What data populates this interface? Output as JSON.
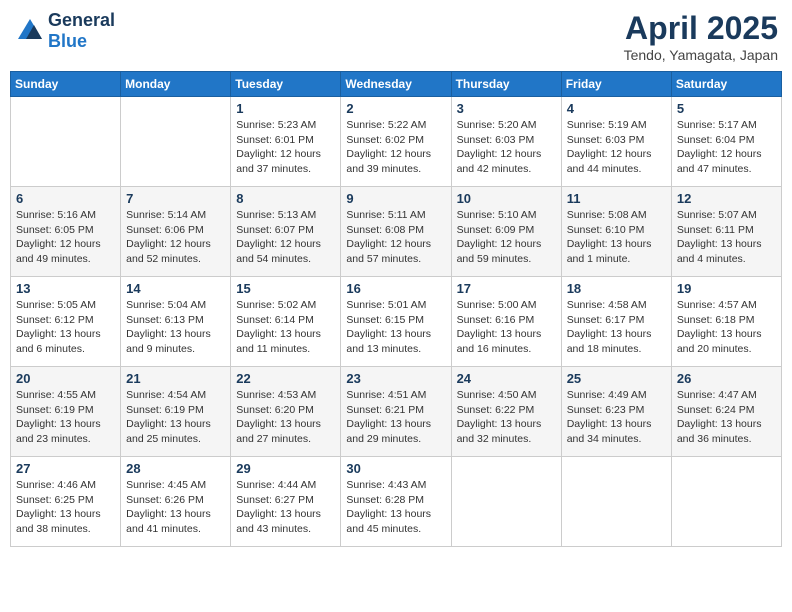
{
  "logo": {
    "general": "General",
    "blue": "Blue"
  },
  "title": "April 2025",
  "location": "Tendo, Yamagata, Japan",
  "days_of_week": [
    "Sunday",
    "Monday",
    "Tuesday",
    "Wednesday",
    "Thursday",
    "Friday",
    "Saturday"
  ],
  "weeks": [
    [
      {
        "day": null
      },
      {
        "day": null
      },
      {
        "day": "1",
        "sunrise": "Sunrise: 5:23 AM",
        "sunset": "Sunset: 6:01 PM",
        "daylight": "Daylight: 12 hours and 37 minutes."
      },
      {
        "day": "2",
        "sunrise": "Sunrise: 5:22 AM",
        "sunset": "Sunset: 6:02 PM",
        "daylight": "Daylight: 12 hours and 39 minutes."
      },
      {
        "day": "3",
        "sunrise": "Sunrise: 5:20 AM",
        "sunset": "Sunset: 6:03 PM",
        "daylight": "Daylight: 12 hours and 42 minutes."
      },
      {
        "day": "4",
        "sunrise": "Sunrise: 5:19 AM",
        "sunset": "Sunset: 6:03 PM",
        "daylight": "Daylight: 12 hours and 44 minutes."
      },
      {
        "day": "5",
        "sunrise": "Sunrise: 5:17 AM",
        "sunset": "Sunset: 6:04 PM",
        "daylight": "Daylight: 12 hours and 47 minutes."
      }
    ],
    [
      {
        "day": "6",
        "sunrise": "Sunrise: 5:16 AM",
        "sunset": "Sunset: 6:05 PM",
        "daylight": "Daylight: 12 hours and 49 minutes."
      },
      {
        "day": "7",
        "sunrise": "Sunrise: 5:14 AM",
        "sunset": "Sunset: 6:06 PM",
        "daylight": "Daylight: 12 hours and 52 minutes."
      },
      {
        "day": "8",
        "sunrise": "Sunrise: 5:13 AM",
        "sunset": "Sunset: 6:07 PM",
        "daylight": "Daylight: 12 hours and 54 minutes."
      },
      {
        "day": "9",
        "sunrise": "Sunrise: 5:11 AM",
        "sunset": "Sunset: 6:08 PM",
        "daylight": "Daylight: 12 hours and 57 minutes."
      },
      {
        "day": "10",
        "sunrise": "Sunrise: 5:10 AM",
        "sunset": "Sunset: 6:09 PM",
        "daylight": "Daylight: 12 hours and 59 minutes."
      },
      {
        "day": "11",
        "sunrise": "Sunrise: 5:08 AM",
        "sunset": "Sunset: 6:10 PM",
        "daylight": "Daylight: 13 hours and 1 minute."
      },
      {
        "day": "12",
        "sunrise": "Sunrise: 5:07 AM",
        "sunset": "Sunset: 6:11 PM",
        "daylight": "Daylight: 13 hours and 4 minutes."
      }
    ],
    [
      {
        "day": "13",
        "sunrise": "Sunrise: 5:05 AM",
        "sunset": "Sunset: 6:12 PM",
        "daylight": "Daylight: 13 hours and 6 minutes."
      },
      {
        "day": "14",
        "sunrise": "Sunrise: 5:04 AM",
        "sunset": "Sunset: 6:13 PM",
        "daylight": "Daylight: 13 hours and 9 minutes."
      },
      {
        "day": "15",
        "sunrise": "Sunrise: 5:02 AM",
        "sunset": "Sunset: 6:14 PM",
        "daylight": "Daylight: 13 hours and 11 minutes."
      },
      {
        "day": "16",
        "sunrise": "Sunrise: 5:01 AM",
        "sunset": "Sunset: 6:15 PM",
        "daylight": "Daylight: 13 hours and 13 minutes."
      },
      {
        "day": "17",
        "sunrise": "Sunrise: 5:00 AM",
        "sunset": "Sunset: 6:16 PM",
        "daylight": "Daylight: 13 hours and 16 minutes."
      },
      {
        "day": "18",
        "sunrise": "Sunrise: 4:58 AM",
        "sunset": "Sunset: 6:17 PM",
        "daylight": "Daylight: 13 hours and 18 minutes."
      },
      {
        "day": "19",
        "sunrise": "Sunrise: 4:57 AM",
        "sunset": "Sunset: 6:18 PM",
        "daylight": "Daylight: 13 hours and 20 minutes."
      }
    ],
    [
      {
        "day": "20",
        "sunrise": "Sunrise: 4:55 AM",
        "sunset": "Sunset: 6:19 PM",
        "daylight": "Daylight: 13 hours and 23 minutes."
      },
      {
        "day": "21",
        "sunrise": "Sunrise: 4:54 AM",
        "sunset": "Sunset: 6:19 PM",
        "daylight": "Daylight: 13 hours and 25 minutes."
      },
      {
        "day": "22",
        "sunrise": "Sunrise: 4:53 AM",
        "sunset": "Sunset: 6:20 PM",
        "daylight": "Daylight: 13 hours and 27 minutes."
      },
      {
        "day": "23",
        "sunrise": "Sunrise: 4:51 AM",
        "sunset": "Sunset: 6:21 PM",
        "daylight": "Daylight: 13 hours and 29 minutes."
      },
      {
        "day": "24",
        "sunrise": "Sunrise: 4:50 AM",
        "sunset": "Sunset: 6:22 PM",
        "daylight": "Daylight: 13 hours and 32 minutes."
      },
      {
        "day": "25",
        "sunrise": "Sunrise: 4:49 AM",
        "sunset": "Sunset: 6:23 PM",
        "daylight": "Daylight: 13 hours and 34 minutes."
      },
      {
        "day": "26",
        "sunrise": "Sunrise: 4:47 AM",
        "sunset": "Sunset: 6:24 PM",
        "daylight": "Daylight: 13 hours and 36 minutes."
      }
    ],
    [
      {
        "day": "27",
        "sunrise": "Sunrise: 4:46 AM",
        "sunset": "Sunset: 6:25 PM",
        "daylight": "Daylight: 13 hours and 38 minutes."
      },
      {
        "day": "28",
        "sunrise": "Sunrise: 4:45 AM",
        "sunset": "Sunset: 6:26 PM",
        "daylight": "Daylight: 13 hours and 41 minutes."
      },
      {
        "day": "29",
        "sunrise": "Sunrise: 4:44 AM",
        "sunset": "Sunset: 6:27 PM",
        "daylight": "Daylight: 13 hours and 43 minutes."
      },
      {
        "day": "30",
        "sunrise": "Sunrise: 4:43 AM",
        "sunset": "Sunset: 6:28 PM",
        "daylight": "Daylight: 13 hours and 45 minutes."
      },
      {
        "day": null
      },
      {
        "day": null
      },
      {
        "day": null
      }
    ]
  ]
}
